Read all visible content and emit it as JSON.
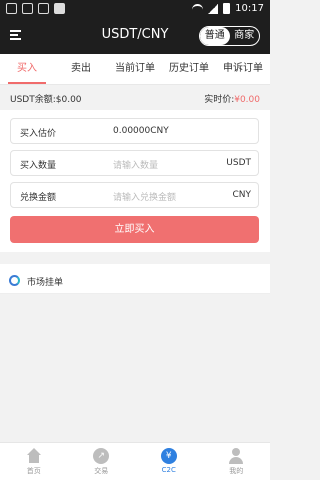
{
  "status_bar": {
    "time": "10:17"
  },
  "header": {
    "title": "USDT/CNY",
    "mode_options": [
      "普通",
      "商家"
    ],
    "mode_selected": "普通"
  },
  "tabs": [
    {
      "label": "买入",
      "active": true
    },
    {
      "label": "卖出",
      "active": false
    },
    {
      "label": "当前订单",
      "active": false
    },
    {
      "label": "历史订单",
      "active": false
    },
    {
      "label": "申诉订单",
      "active": false
    }
  ],
  "balance": {
    "label": "USDT余额:$0.00",
    "price_label": "实时价:",
    "price_value": "¥0.00"
  },
  "form": {
    "estimate": {
      "label": "买入估价",
      "value": "0.00000CNY"
    },
    "quantity": {
      "label": "买入数量",
      "placeholder": "请输入数量",
      "unit": "USDT"
    },
    "amount": {
      "label": "兑换金额",
      "placeholder": "请输入兑换金额",
      "unit": "CNY"
    },
    "submit_label": "立即买入"
  },
  "market": {
    "title": "市场挂单"
  },
  "bottom_nav": [
    {
      "label": "首页",
      "icon": "home-icon",
      "active": false
    },
    {
      "label": "交易",
      "icon": "trade-icon",
      "active": false
    },
    {
      "label": "C2C",
      "icon": "yen-icon",
      "active": true
    },
    {
      "label": "我的",
      "icon": "user-icon",
      "active": false
    }
  ],
  "colors": {
    "accent": "#f06b6b",
    "button": "#f07070",
    "nav_active": "#2f80e0",
    "header_bg": "#1e1e1e"
  }
}
